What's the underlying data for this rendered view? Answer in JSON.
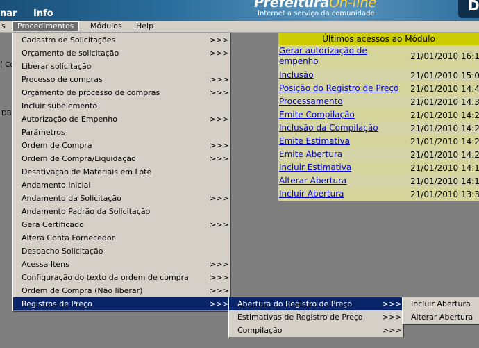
{
  "banner": {
    "top_nav": [
      "nar",
      "Info"
    ],
    "logo_title": "Prefeitura",
    "logo_title_suffix": "On-line",
    "logo_subtitle": "Internet a serviço da comunidade",
    "logo_badge": "D"
  },
  "menubar": {
    "items": [
      "s",
      "Procedimentos",
      "Módulos",
      "Help"
    ]
  },
  "left_fragments": [
    "( Co",
    "DB"
  ],
  "procedimentos_menu": {
    "items": [
      {
        "label": "Cadastro de Solicitações",
        "arrow": ">>>"
      },
      {
        "label": "Orçamento de solicitação",
        "arrow": ">>>"
      },
      {
        "label": "Liberar solicitação",
        "arrow": ""
      },
      {
        "label": "Processo de compras",
        "arrow": ">>>"
      },
      {
        "label": "Orçamento de processo de compras",
        "arrow": ">>>"
      },
      {
        "label": "Incluir subelemento",
        "arrow": ""
      },
      {
        "label": "Autorização de Empenho",
        "arrow": ">>>"
      },
      {
        "label": "Parâmetros",
        "arrow": ""
      },
      {
        "label": "Ordem de Compra",
        "arrow": ">>>"
      },
      {
        "label": "Ordem de Compra/Liquidação",
        "arrow": ">>>"
      },
      {
        "label": "Desativação de Materiais em Lote",
        "arrow": ""
      },
      {
        "label": "Andamento Inicial",
        "arrow": ""
      },
      {
        "label": "Andamento da Solicitação",
        "arrow": ">>>"
      },
      {
        "label": "Andamento Padrão da Solicitação",
        "arrow": ""
      },
      {
        "label": "Gera Certificado",
        "arrow": ">>>"
      },
      {
        "label": "Altera Conta Fornecedor",
        "arrow": ""
      },
      {
        "label": "Despacho Solicitação",
        "arrow": ""
      },
      {
        "label": "Acessa Itens",
        "arrow": ">>>"
      },
      {
        "label": "Configuração do texto da ordem de compra",
        "arrow": ">>>"
      },
      {
        "label": "Ordem de Compra (Não liberar)",
        "arrow": ">>>"
      },
      {
        "label": "Registros de Preço",
        "arrow": ">>>"
      }
    ]
  },
  "registros_menu": {
    "items": [
      {
        "label": "Abertura do Registro de Preço",
        "arrow": ">>>"
      },
      {
        "label": "Estimativas de Registro de Preço",
        "arrow": ">>>"
      },
      {
        "label": "Compilação",
        "arrow": ">>>"
      }
    ]
  },
  "abertura_menu": {
    "items": [
      {
        "label": "Incluir Abertura"
      },
      {
        "label": "Alterar Abertura"
      }
    ]
  },
  "ultimos_acessos": {
    "title": "Últimos acessos ao Módulo",
    "rows": [
      {
        "link": "Gerar autorização de empenho",
        "time": "21/01/2010 16:1"
      },
      {
        "link": "Inclusão",
        "time": "21/01/2010 15:0"
      },
      {
        "link": "Posição do Registro de Preço",
        "time": "21/01/2010 14:4"
      },
      {
        "link": "Processamento",
        "time": "21/01/2010 14:3"
      },
      {
        "link": "Emite Compilação",
        "time": "21/01/2010 14:2"
      },
      {
        "link": "Inclusão da Compilação",
        "time": "21/01/2010 14:2"
      },
      {
        "link": "Emite Estimativa",
        "time": "21/01/2010 14:2"
      },
      {
        "link": "Emite Abertura",
        "time": "21/01/2010 14:2"
      },
      {
        "link": "Incluir Estimativa",
        "time": "21/01/2010 14:1"
      },
      {
        "link": "Alterar Abertura",
        "time": "21/01/2010 14:1"
      },
      {
        "link": "Incluir Abertura",
        "time": "21/01/2010 13:3"
      }
    ]
  },
  "colors": {
    "menu_bg": "#d4d0c8",
    "menu_selected": "#0a246a",
    "table_header": "#cccc00",
    "link": "#0000cc"
  }
}
